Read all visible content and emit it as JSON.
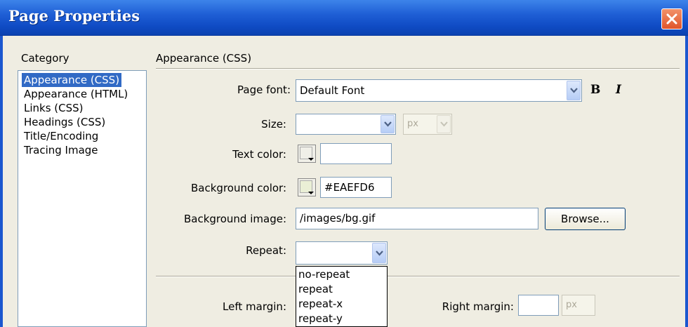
{
  "window": {
    "title": "Page Properties"
  },
  "category": {
    "heading": "Category",
    "items": [
      {
        "label": "Appearance (CSS)",
        "selected": true
      },
      {
        "label": "Appearance (HTML)"
      },
      {
        "label": "Links (CSS)"
      },
      {
        "label": "Headings (CSS)"
      },
      {
        "label": "Title/Encoding"
      },
      {
        "label": "Tracing Image"
      }
    ]
  },
  "section": {
    "heading": "Appearance (CSS)"
  },
  "form": {
    "page_font": {
      "label": "Page font:",
      "value": "Default Font",
      "bold": "B",
      "italic": "I"
    },
    "size": {
      "label": "Size:",
      "value": "",
      "unit": "px"
    },
    "text_color": {
      "label": "Text color:",
      "value": ""
    },
    "background_color": {
      "label": "Background color:",
      "value": "#EAEFD6",
      "swatch": "#EAEFD6"
    },
    "background_image": {
      "label": "Background image:",
      "value": "/images/bg.gif",
      "browse": "Browse..."
    },
    "repeat": {
      "label": "Repeat:",
      "value": "",
      "options": [
        "no-repeat",
        "repeat",
        "repeat-x",
        "repeat-y"
      ]
    },
    "left_margin": {
      "label": "Left margin:"
    },
    "right_margin": {
      "label": "Right margin:",
      "value": "",
      "unit": "px"
    }
  },
  "colors": {
    "title_bar": "#0f4bc4",
    "dialog_bg": "#efede2",
    "selection": "#316ac5"
  }
}
